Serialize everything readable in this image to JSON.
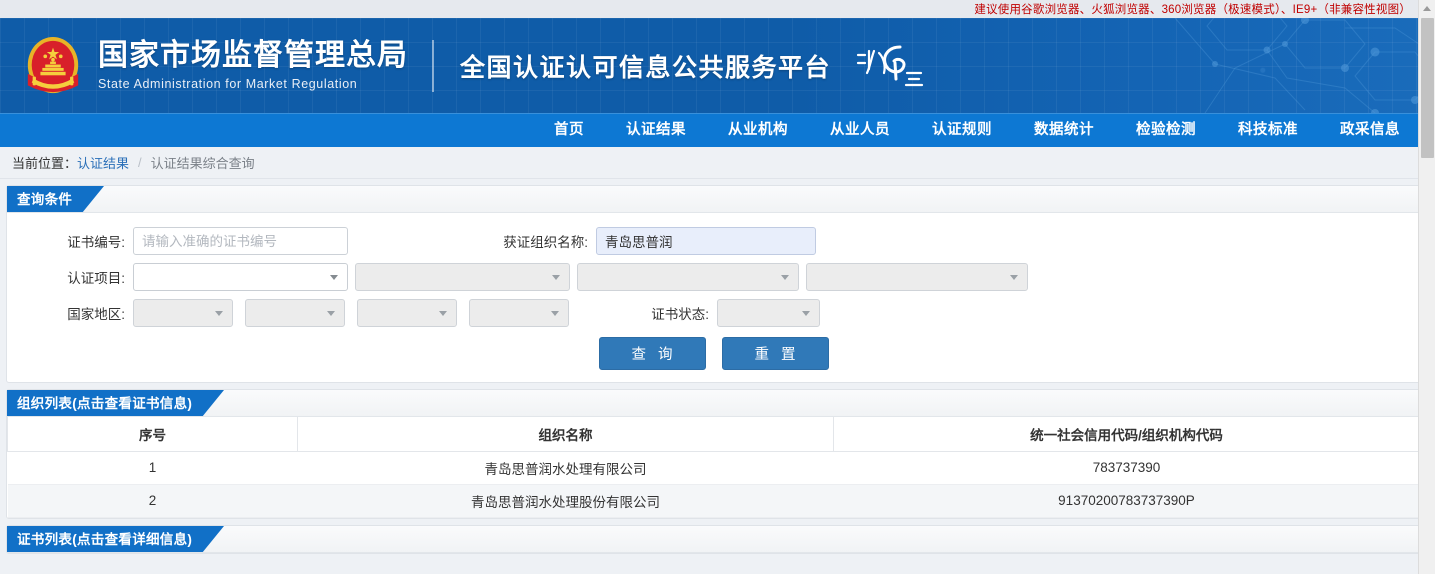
{
  "advice": {
    "text": "建议使用谷歌浏览器、火狐浏览器、360浏览器（极速模式）、IE9+（非兼容性视图）"
  },
  "header": {
    "brand_cn": "国家市场监督管理总局",
    "brand_en": "State Administration  for  Market Regulation",
    "platform_title": "全国认证认可信息公共服务平台",
    "logo_alt": "认e云",
    "emblem_name": "national-emblem",
    "accent_color": "#0d78d3",
    "header_bg_color": "#0f5ca8"
  },
  "nav": {
    "items": [
      {
        "label": "首页"
      },
      {
        "label": "认证结果"
      },
      {
        "label": "从业机构"
      },
      {
        "label": "从业人员"
      },
      {
        "label": "认证规则"
      },
      {
        "label": "数据统计"
      },
      {
        "label": "检验检测"
      },
      {
        "label": "科技标准"
      },
      {
        "label": "政采信息"
      }
    ]
  },
  "breadcrumb": {
    "prefix": "当前位置：",
    "link": "认证结果",
    "separator": "/",
    "current": "认证结果综合查询"
  },
  "query_panel": {
    "title": "查询条件",
    "fields": {
      "cert_no": {
        "label": "证书编号:",
        "placeholder": "请输入准确的证书编号",
        "value": ""
      },
      "org_name": {
        "label": "获证组织名称:",
        "placeholder": "",
        "value": "青岛思普润"
      },
      "cert_project": {
        "label": "认证项目:",
        "selects": [
          {
            "value": "",
            "enabled": true
          },
          {
            "value": "",
            "enabled": false
          },
          {
            "value": "",
            "enabled": false
          },
          {
            "value": "",
            "enabled": false
          }
        ]
      },
      "country_region": {
        "label": "国家地区:",
        "selects": [
          {
            "value": "",
            "enabled": false
          },
          {
            "value": "",
            "enabled": false
          },
          {
            "value": "",
            "enabled": false
          },
          {
            "value": "",
            "enabled": false
          }
        ]
      },
      "cert_status": {
        "label": "证书状态:",
        "value": ""
      }
    },
    "buttons": {
      "search": "查 询",
      "reset": "重 置"
    }
  },
  "org_panel": {
    "title": "组织列表(点击查看证书信息)",
    "columns": [
      "序号",
      "组织名称",
      "统一社会信用代码/组织机构代码"
    ],
    "rows": [
      {
        "index": "1",
        "name": "青岛思普润水处理有限公司",
        "code": "783737390"
      },
      {
        "index": "2",
        "name": "青岛思普润水处理股份有限公司",
        "code": "91370200783737390P"
      }
    ]
  },
  "cert_panel": {
    "title": "证书列表(点击查看详细信息)"
  }
}
